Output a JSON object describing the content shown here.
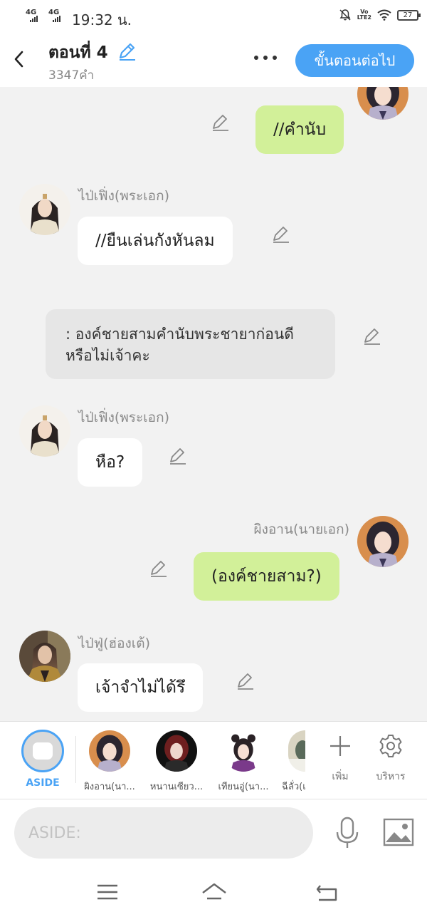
{
  "status_bar": {
    "signal1": "4G",
    "signal2": "4G",
    "time": "19:32 น.",
    "volte_top": "Vo",
    "volte_bottom": "LTE2",
    "battery": "27"
  },
  "header": {
    "title": "ตอนที่ 4",
    "word_count": "3347คำ",
    "next_button": "ขั้นตอนต่อไป"
  },
  "messages": [
    {
      "text": "//คำนับ"
    },
    {
      "speaker": "ไป่เฟิ่ง(พระเอก)",
      "text": "//ยืนเล่นกังหันลม"
    },
    {
      "narration_line1": ": องค์ชายสามคำนับพระชายาก่อนดี",
      "narration_line2": "หรือไม่เจ้าคะ"
    },
    {
      "speaker": "ไป่เฟิ่ง(พระเอก)",
      "text": "หือ?"
    },
    {
      "speaker": "ผิงอาน(นายเอก)",
      "text": "(องค์ชายสาม?)"
    },
    {
      "speaker": "ไป่ฟู่(ฮ่องเต้)",
      "text": "เจ้าจำไม่ได้รึ"
    }
  ],
  "character_bar": {
    "aside_label": "ASIDE",
    "characters": [
      {
        "name": "ผิงอาน(นา..."
      },
      {
        "name": "หนานเซียว..."
      },
      {
        "name": "เทียนอู่(นา..."
      },
      {
        "name": "ฉีลั่ว(เ"
      }
    ],
    "add_label": "เพิ่ม",
    "manage_label": "บริหาร"
  },
  "input": {
    "placeholder": "ASIDE:"
  },
  "colors": {
    "accent": "#4aa3f5",
    "right_bubble": "#d2f099",
    "left_bubble": "#ffffff",
    "chat_background": "#f2f2f2",
    "narration_bubble": "#e6e6e6"
  },
  "icons": [
    "back-arrow-icon",
    "pencil-icon",
    "more-dots-icon",
    "edit-icon",
    "plus-icon",
    "gear-icon",
    "microphone-icon",
    "image-icon",
    "menu-icon",
    "home-icon",
    "return-icon"
  ]
}
